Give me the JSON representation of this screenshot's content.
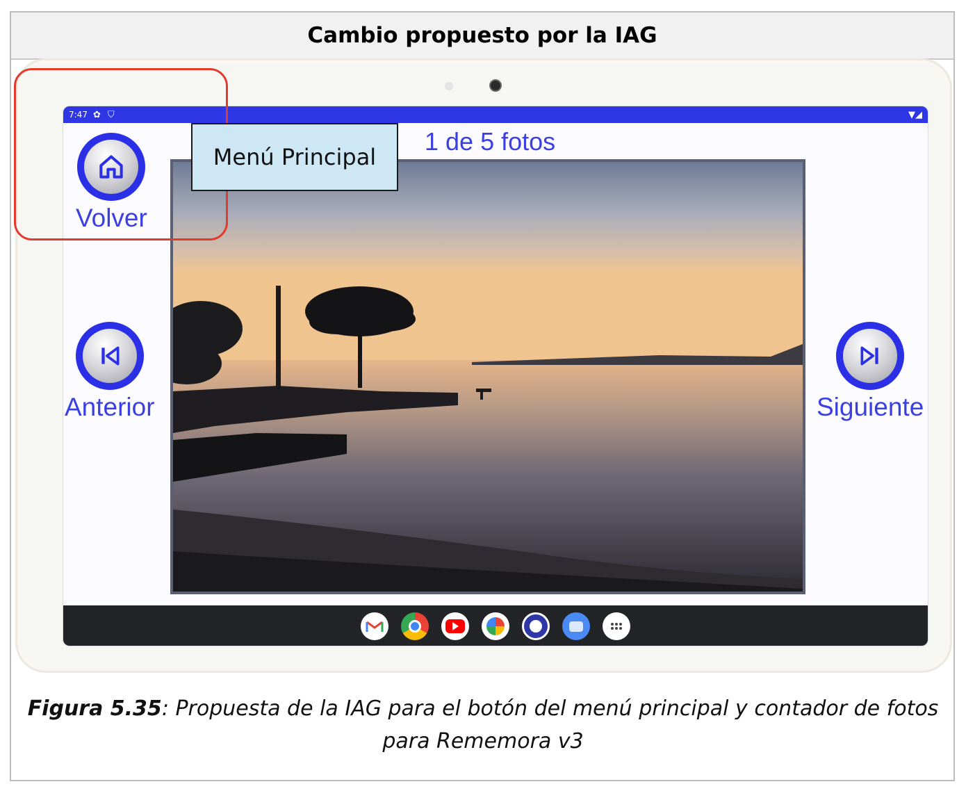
{
  "header": {
    "title": "Cambio propuesto por la IAG"
  },
  "statusbar": {
    "time": "7:47",
    "icons": [
      "gear-icon",
      "shield-icon"
    ],
    "right_icons": [
      "wifi-icon",
      "signal-icon"
    ]
  },
  "viewer": {
    "counter": "1 de 5 fotos",
    "photo_description_icon": "sunset-lake-photo"
  },
  "buttons": {
    "home": {
      "label": "Volver",
      "icon": "home-icon"
    },
    "previous": {
      "label": "Anterior",
      "icon": "skip-previous-icon"
    },
    "next": {
      "label": "Siguiente",
      "icon": "skip-next-icon"
    }
  },
  "callout": {
    "text": "Menú Principal"
  },
  "taskbar": {
    "apps": [
      "gmail-icon",
      "chrome-icon",
      "youtube-icon",
      "photos-icon",
      "rememora-icon",
      "messages-icon",
      "app-drawer-icon"
    ]
  },
  "caption": {
    "label": "Figura 5.35",
    "text": ": Propuesta de la IAG para el botón del menú principal y contador de fotos para Rememora v3"
  },
  "colors": {
    "accent": "#2f36e6",
    "highlight": "#e23a2d",
    "callout_bg": "#cde7f4"
  }
}
